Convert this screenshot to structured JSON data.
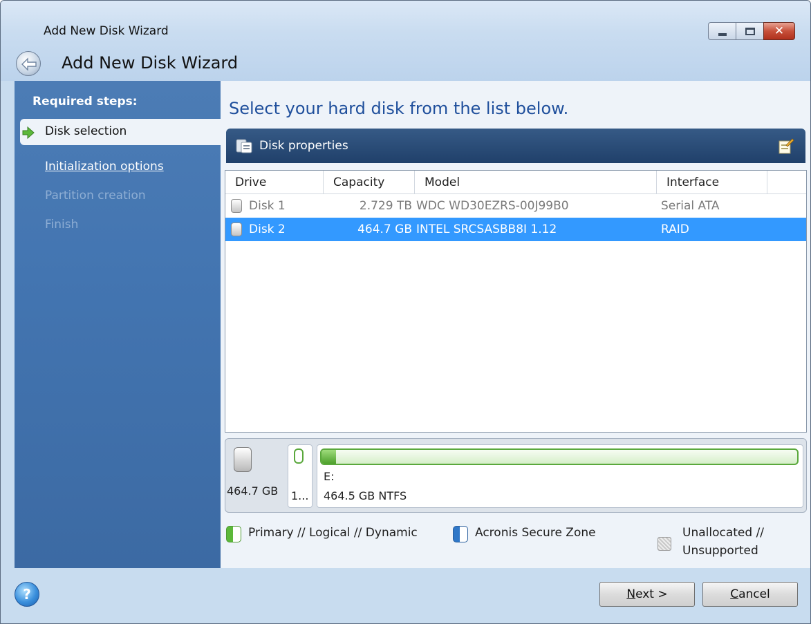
{
  "window": {
    "title": "Add New Disk Wizard",
    "wizard_title": "Add New Disk Wizard",
    "close_glyph": "✕"
  },
  "sidebar": {
    "heading": "Required steps:",
    "items": [
      {
        "label": "Disk selection",
        "state": "active"
      },
      {
        "label": "Initialization options",
        "state": "link"
      },
      {
        "label": "Partition creation",
        "state": "disabled"
      },
      {
        "label": "Finish",
        "state": "disabled"
      }
    ]
  },
  "main": {
    "heading": "Select your hard disk from the list below.",
    "panel_title": "Disk properties",
    "columns": [
      "Drive",
      "Capacity",
      "Model",
      "Interface"
    ],
    "rows": [
      {
        "drive": "Disk 1",
        "capacity": "2.729 TB",
        "model": "WDC WD30EZRS-00J99B0",
        "interface": "Serial ATA",
        "selected": false
      },
      {
        "drive": "Disk 2",
        "capacity": "464.7 GB",
        "model": "INTEL SRCSASBB8I 1.12",
        "interface": "RAID",
        "selected": true
      }
    ]
  },
  "disk_map": {
    "disk_size": "464.7 GB",
    "small_partition_label": "1...",
    "partition_letter": "E:",
    "partition_size": "464.5 GB  NTFS",
    "partition_used_fraction": 0.03
  },
  "legend": {
    "primary": "Primary // Logical // Dynamic",
    "secure_zone": "Acronis Secure Zone",
    "unallocated_line1": "Unallocated //",
    "unallocated_line2": "Unsupported"
  },
  "footer": {
    "help_glyph": "?",
    "next_key": "N",
    "next_rest": "ext >",
    "cancel_key": "C",
    "cancel_rest": "ancel"
  },
  "colors": {
    "selection": "#3399ff",
    "sidebar": "#4375b1",
    "heading": "#1f4f9c",
    "panel_bar": "#2a4a74",
    "partition_green": "#5aa83c"
  }
}
